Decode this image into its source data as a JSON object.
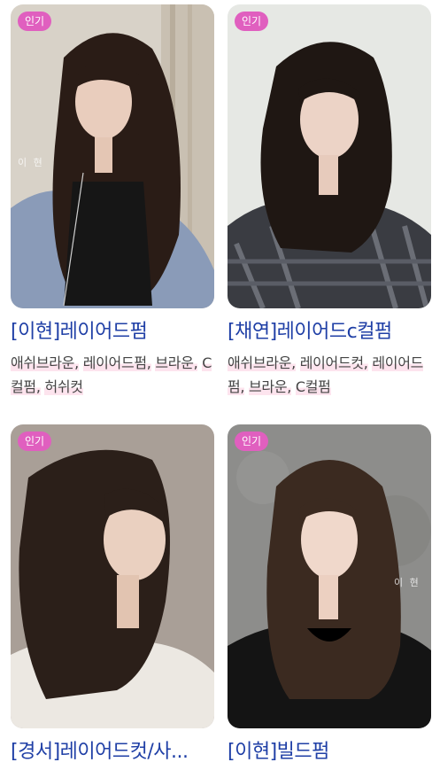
{
  "cards": [
    {
      "badge": "인기",
      "title": "[이현]레이어드펌",
      "tags": [
        "애쉬브라운,",
        "레이어드펌,",
        "브라운,",
        "C컬펌,",
        "허쉬컷"
      ],
      "watermark": "이 현"
    },
    {
      "badge": "인기",
      "title": "[채연]레이어드c컬펌",
      "tags": [
        "애쉬브라운,",
        "레이어드컷,",
        "레이어드펌,",
        "브라운,",
        "C컬펌"
      ]
    },
    {
      "badge": "인기",
      "title": "[경서]레이어드컷/사..."
    },
    {
      "badge": "인기",
      "title": "[이현]빌드펌",
      "watermark": "이 현"
    }
  ],
  "colors": {
    "badge": "#e05fbf",
    "title": "#1f3fa6",
    "tag_highlight": "#fde4ee"
  }
}
